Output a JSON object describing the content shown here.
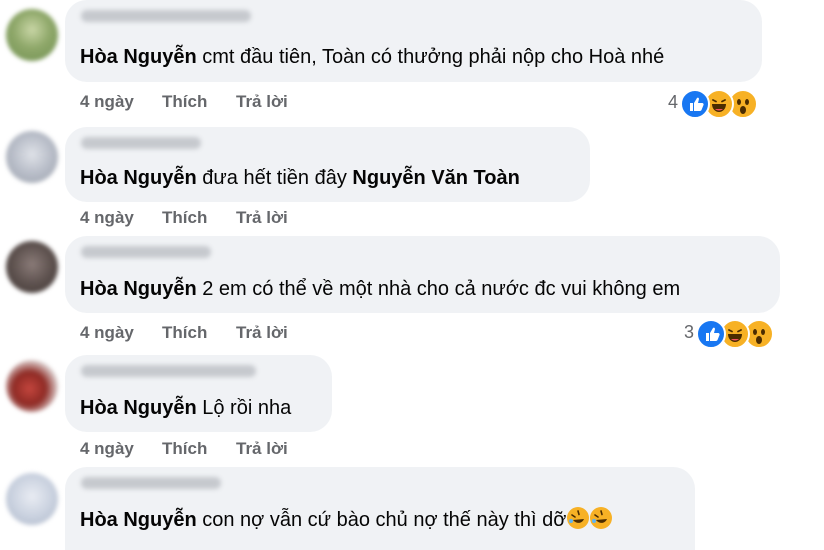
{
  "comments": [
    {
      "author": "Hòa Nguyễn",
      "text": "cmt đầu tiên, Toàn có thưởng phải nộp cho Hoà nhé",
      "time": "4 ngày",
      "like": "Thích",
      "reply": "Trả lời",
      "reaction_count": "4",
      "reactions": [
        "like",
        "haha",
        "wow"
      ]
    },
    {
      "author": "Hòa Nguyễn",
      "text": "đưa hết tiền đây",
      "mention": "Nguyễn Văn Toàn",
      "time": "4 ngày",
      "like": "Thích",
      "reply": "Trả lời"
    },
    {
      "author": "Hòa Nguyễn",
      "text": "2 em có thể về một nhà cho cả nước đc vui không em",
      "time": "4 ngày",
      "like": "Thích",
      "reply": "Trả lời",
      "reaction_count": "3",
      "reactions": [
        "like",
        "haha",
        "wow"
      ]
    },
    {
      "author": "Hòa Nguyễn",
      "text": "Lộ rồi nha",
      "time": "4 ngày",
      "like": "Thích",
      "reply": "Trả lời"
    },
    {
      "author": "Hòa Nguyễn",
      "text": "con nợ vẫn cứ bào chủ nợ thế này thì dỡ",
      "trailing_emoji": [
        "rolling-laughing",
        "rolling-laughing"
      ]
    }
  ],
  "colors": {
    "bubble": "#f0f2f5",
    "secondary_text": "#65676b",
    "like_blue": "#1877f2",
    "emoji_yellow": "#f7b125"
  }
}
